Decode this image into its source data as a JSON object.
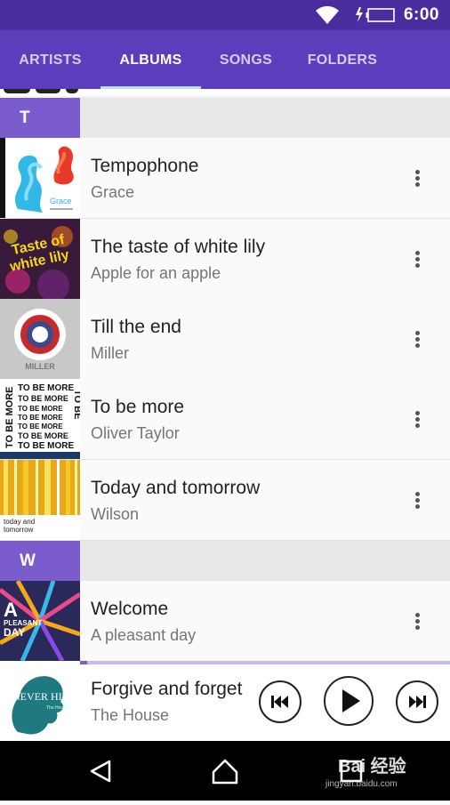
{
  "status_bar": {
    "time": "6:00",
    "wifi_icon": "wifi-icon",
    "battery_icon": "battery-charging-icon"
  },
  "tabs": [
    {
      "label": "ARTISTS",
      "active": false
    },
    {
      "label": "ALBUMS",
      "active": true
    },
    {
      "label": "SONGS",
      "active": false
    },
    {
      "label": "FOLDERS",
      "active": false
    }
  ],
  "sections": [
    {
      "letter": "T",
      "albums": [
        {
          "title": "Tempophone",
          "artist": "Grace",
          "cover_text": "Grace"
        },
        {
          "title": "The taste of white lily",
          "artist": "Apple for an apple",
          "cover_text": "Taste of white lily"
        },
        {
          "title": "Till the end",
          "artist": "Miller",
          "cover_text": "MILLER"
        },
        {
          "title": "To be more",
          "artist": "Oliver Taylor",
          "cover_text": "TO BE MORE"
        },
        {
          "title": "Today and tomorrow",
          "artist": "Wilson",
          "cover_text": "today and tomorrow"
        }
      ]
    },
    {
      "letter": "W",
      "albums": [
        {
          "title": "Welcome",
          "artist": "A pleasant day",
          "cover_text": "A PLEASANT DAY"
        }
      ]
    }
  ],
  "now_playing": {
    "title": "Forgive and forget",
    "artist": "The House",
    "cover_text": "NEVER HIDE",
    "progress": 0.02,
    "controls": {
      "previous_icon": "skip-previous-icon",
      "play_icon": "play-icon",
      "next_icon": "skip-next-icon"
    }
  },
  "nav_bar": {
    "back_icon": "back-icon",
    "home_icon": "home-icon",
    "recents_icon": "recents-icon"
  },
  "watermark": {
    "text": "Bai 经验",
    "url": "jingyan.baidu.com"
  },
  "colors": {
    "primary": "#5c3ebc",
    "status_bar": "#4a2ea0",
    "section_letter_bg": "#7a5ccc",
    "tab_indicator": "#b8e0f4"
  }
}
